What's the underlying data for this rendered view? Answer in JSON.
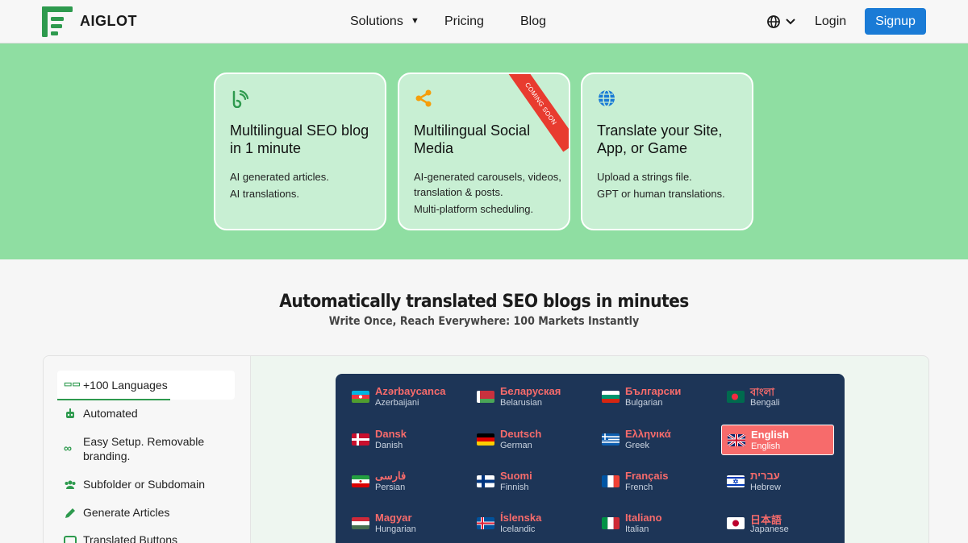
{
  "header": {
    "brand": "AIGLOT",
    "nav": {
      "solutions": "Solutions",
      "pricing": "Pricing",
      "blog": "Blog"
    },
    "login": "Login",
    "signup": "Signup"
  },
  "cards": [
    {
      "title": "Multilingual SEO blog in 1 minute",
      "lines": [
        "AI generated articles.",
        "AI translations."
      ],
      "icon": "blog-icon"
    },
    {
      "title": "Multilingual Social Media",
      "lines": [
        "AI-generated carousels, videos, translation & posts.",
        "Multi-platform scheduling."
      ],
      "icon": "share-icon",
      "ribbon": "COMING SOON"
    },
    {
      "title": "Translate your Site, App, or Game",
      "lines": [
        "Upload a strings file.",
        "GPT or human translations."
      ],
      "icon": "globe-icon"
    }
  ],
  "section": {
    "title": "Automatically translated SEO blogs in minutes",
    "subtitle": "Write Once, Reach Everywhere: 100 Markets Instantly"
  },
  "features": [
    {
      "label": "+100 Languages",
      "icon": "languages-icon"
    },
    {
      "label": "Automated",
      "icon": "robot-icon"
    },
    {
      "label": "Easy Setup. Removable branding.",
      "icon": "infinity-icon"
    },
    {
      "label": "Subfolder or Subdomain",
      "icon": "users-icon"
    },
    {
      "label": "Generate Articles",
      "icon": "pencil-icon"
    },
    {
      "label": "Translated Buttons",
      "icon": "button-icon"
    }
  ],
  "languages": [
    {
      "native": "Azərbaycanca",
      "english": "Azerbaijani"
    },
    {
      "native": "Беларуская",
      "english": "Belarusian"
    },
    {
      "native": "Български",
      "english": "Bulgarian"
    },
    {
      "native": "বাংলা",
      "english": "Bengali"
    },
    {
      "native": "Dansk",
      "english": "Danish"
    },
    {
      "native": "Deutsch",
      "english": "German"
    },
    {
      "native": "Ελληνικά",
      "english": "Greek"
    },
    {
      "native": "English",
      "english": "English",
      "selected": true
    },
    {
      "native": "فارسی",
      "english": "Persian"
    },
    {
      "native": "Suomi",
      "english": "Finnish"
    },
    {
      "native": "Français",
      "english": "French"
    },
    {
      "native": "עברית",
      "english": "Hebrew"
    },
    {
      "native": "Magyar",
      "english": "Hungarian"
    },
    {
      "native": "Íslenska",
      "english": "Icelandic"
    },
    {
      "native": "Italiano",
      "english": "Italian"
    },
    {
      "native": "日本語",
      "english": "Japanese"
    }
  ],
  "colors": {
    "accent": "#1a7bd6",
    "hero": "#8fdea2",
    "card": "#c8efd3",
    "grid": "#1d3557",
    "highlight": "#f76b6b",
    "green": "#2e9a4e"
  }
}
